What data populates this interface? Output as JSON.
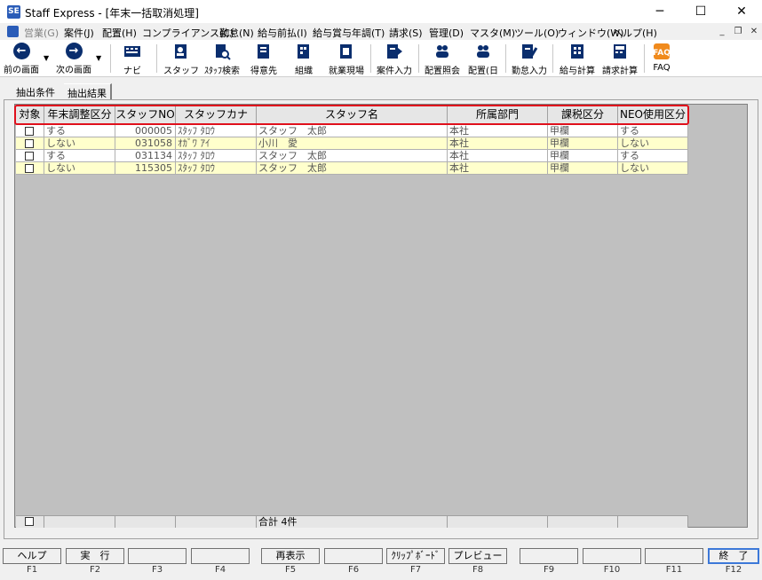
{
  "window": {
    "title": "Staff Express - [年末一括取消処理]",
    "app_icon": "SE",
    "controls": {
      "minimize": "─",
      "maximize": "☐",
      "close": "✕"
    }
  },
  "menu": {
    "items": [
      {
        "label": "営業(G)",
        "enabled": false
      },
      {
        "label": "案件(J)",
        "enabled": true
      },
      {
        "label": "配置(H)",
        "enabled": true
      },
      {
        "label": "コンプライアンス(C)",
        "enabled": true
      },
      {
        "label": "勤怠(N)",
        "enabled": true
      },
      {
        "label": "給与前払(I)",
        "enabled": true
      },
      {
        "label": "給与賞与年調(T)",
        "enabled": true
      },
      {
        "label": "請求(S)",
        "enabled": true
      },
      {
        "label": "管理(D)",
        "enabled": true
      },
      {
        "label": "マスタ(M)",
        "enabled": true
      },
      {
        "label": "ツール(O)",
        "enabled": true
      },
      {
        "label": "ウィンドウ(W)",
        "enabled": true
      },
      {
        "label": "ヘルプ(H)",
        "enabled": true
      }
    ],
    "mdi_controls": {
      "minimize": "_",
      "restore": "❐",
      "close": "✕"
    }
  },
  "toolbar": {
    "back": "前の画面",
    "forward": "次の画面",
    "navi": "ナビ",
    "staff": "スタッフ",
    "staff_search": "ｽﾀｯﾌ検索",
    "client": "得意先",
    "organization": "組織",
    "worksite": "就業現場",
    "job_entry": "案件入力",
    "placement_inquiry": "配置照会",
    "placement_daily": "配置(日",
    "attendance_entry": "勤怠入力",
    "payroll_calc": "給与計算",
    "billing_calc": "請求計算",
    "faq": "FAQ"
  },
  "tabs": {
    "conditions": "抽出条件",
    "results": "抽出結果"
  },
  "grid": {
    "columns": [
      "対象",
      "年末調整区分",
      "スタッフNO",
      "スタッフカナ",
      "スタッフ名",
      "所属部門",
      "課税区分",
      "NEO使用区分"
    ],
    "rows": [
      {
        "adj": "する",
        "no": "000005",
        "kana": "ｽﾀｯﾌ ﾀﾛｳ",
        "name": "スタッフ　太郎",
        "dept": "本社",
        "tax": "甲欄",
        "neo": "する"
      },
      {
        "adj": "しない",
        "no": "031058",
        "kana": "ｵｶﾞﾜ ｱｲ",
        "name": "小川　愛",
        "dept": "本社",
        "tax": "甲欄",
        "neo": "しない"
      },
      {
        "adj": "する",
        "no": "031134",
        "kana": "ｽﾀｯﾌ ﾀﾛｳ",
        "name": "スタッフ　太郎",
        "dept": "本社",
        "tax": "甲欄",
        "neo": "する"
      },
      {
        "adj": "しない",
        "no": "115305",
        "kana": "ｽﾀｯﾌ ﾀﾛｳ",
        "name": "スタッフ　太郎",
        "dept": "本社",
        "tax": "甲欄",
        "neo": "しない"
      }
    ],
    "total": "合計 4件",
    "colors": {
      "highlight": "#e0101c",
      "row_alt": "#ffffcc",
      "grid_bg": "#c0c0c0"
    }
  },
  "function_keys": [
    {
      "label": "ヘルプ",
      "key": "F1"
    },
    {
      "label": "実　行",
      "key": "F2"
    },
    {
      "label": "",
      "key": "F3"
    },
    {
      "label": "",
      "key": "F4"
    },
    {
      "label": "再表示",
      "key": "F5"
    },
    {
      "label": "",
      "key": "F6"
    },
    {
      "label": "ｸﾘｯﾌﾟﾎﾞｰﾄﾞ",
      "key": "F7"
    },
    {
      "label": "プレビュー",
      "key": "F8"
    },
    {
      "label": "",
      "key": "F9"
    },
    {
      "label": "",
      "key": "F10"
    },
    {
      "label": "",
      "key": "F11"
    },
    {
      "label": "終　了",
      "key": "F12"
    }
  ]
}
